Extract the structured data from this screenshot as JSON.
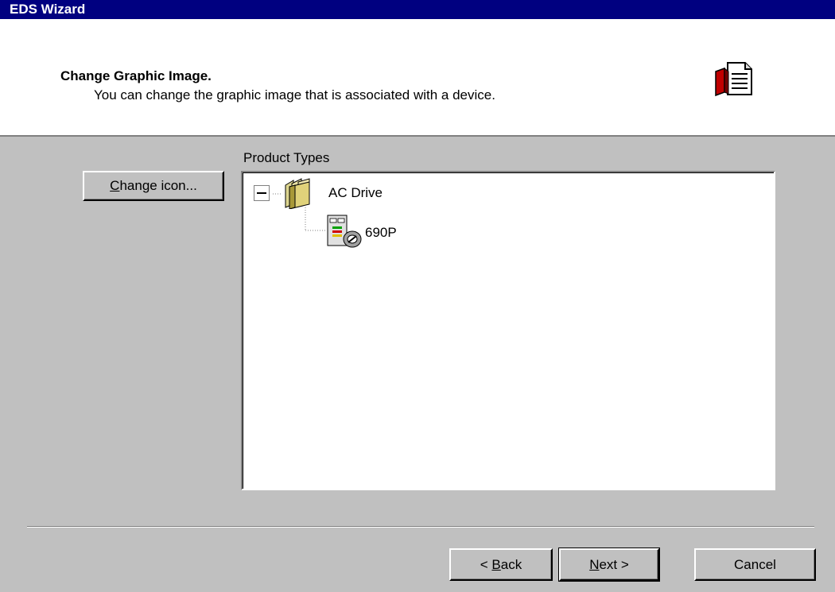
{
  "window": {
    "title": "EDS Wizard"
  },
  "header": {
    "title": "Change Graphic Image.",
    "subtitle": "You can change the graphic image that is associated with a device."
  },
  "change_icon_button": {
    "underline": "C",
    "rest": "hange icon..."
  },
  "tree": {
    "group_label": "Product Types",
    "root": {
      "label": "AC Drive",
      "expanded": true
    },
    "children": [
      {
        "label": "690P"
      }
    ]
  },
  "footer": {
    "back": {
      "prefix": "< ",
      "underline": "B",
      "rest": "ack"
    },
    "next": {
      "underline": "N",
      "rest": "ext >"
    },
    "cancel": "Cancel"
  }
}
